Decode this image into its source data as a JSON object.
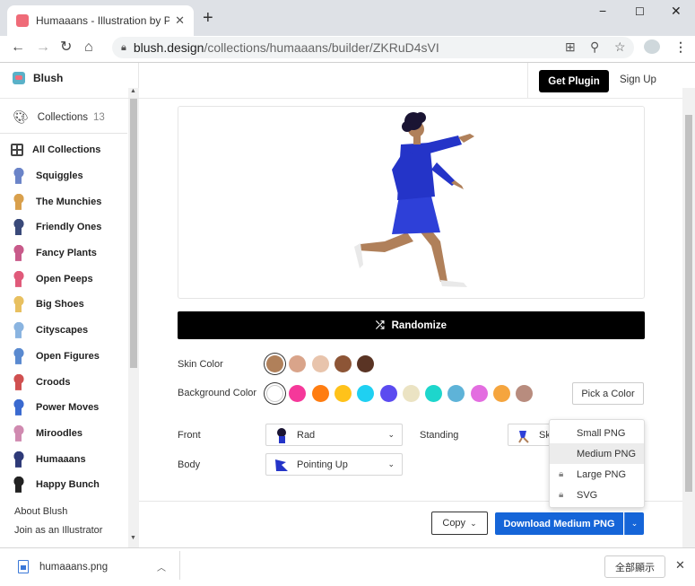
{
  "browser": {
    "tab_title": "Humaaans - Illustration by Pablo Stanley",
    "tab_close": "✕",
    "new_tab": "+",
    "url_host": "blush.design",
    "url_path": "/collections/humaaans/builder/ZKRuD4sVI",
    "window_controls": [
      "−",
      "☐",
      "✕"
    ]
  },
  "header": {
    "brand": "Blush",
    "get_plugin": "Get Plugin",
    "sign_up": "Sign Up"
  },
  "sidebar": {
    "collections_label": "Collections",
    "collections_count": "13",
    "items": [
      {
        "label": "All Collections",
        "icon": "grid-icon"
      },
      {
        "label": "Squiggles",
        "icon": "squiggles-thumb"
      },
      {
        "label": "The Munchies",
        "icon": "munchies-thumb"
      },
      {
        "label": "Friendly Ones",
        "icon": "friendly-ones-thumb"
      },
      {
        "label": "Fancy Plants",
        "icon": "fancy-plants-thumb"
      },
      {
        "label": "Open Peeps",
        "icon": "open-peeps-thumb"
      },
      {
        "label": "Big Shoes",
        "icon": "big-shoes-thumb"
      },
      {
        "label": "Cityscapes",
        "icon": "cityscapes-thumb"
      },
      {
        "label": "Open Figures",
        "icon": "open-figures-thumb"
      },
      {
        "label": "Croods",
        "icon": "croods-thumb"
      },
      {
        "label": "Power Moves",
        "icon": "power-moves-thumb"
      },
      {
        "label": "Miroodles",
        "icon": "miroodles-thumb"
      },
      {
        "label": "Humaaans",
        "icon": "humaaans-thumb"
      },
      {
        "label": "Happy Bunch",
        "icon": "happy-bunch-thumb"
      }
    ],
    "about": "About Blush",
    "join": "Join as an Illustrator"
  },
  "builder": {
    "randomize": "Randomize",
    "skin_color_label": "Skin Color",
    "skin_colors": [
      "#b0805a",
      "#d9a48a",
      "#e8c4ac",
      "#8d5536",
      "#5a3424"
    ],
    "background_color_label": "Background Color",
    "background_colors": [
      "#ffffff",
      "#f5389a",
      "#ff7d11",
      "#ffc21a",
      "#1fd0f2",
      "#5b4bf0",
      "#ebe3c3",
      "#1dd6cc",
      "#5eb3d8",
      "#e36de0",
      "#f5a53e",
      "#b88c7e"
    ],
    "pick_color": "Pick a Color",
    "front_label": "Front",
    "front_value": "Rad",
    "standing_label": "Standing",
    "standing_value": "Sk",
    "body_label": "Body",
    "body_value": "Pointing Up"
  },
  "actions": {
    "copy": "Copy",
    "download": "Download Medium PNG",
    "download_options": [
      {
        "label": "Small PNG",
        "locked": false
      },
      {
        "label": "Medium PNG",
        "locked": false
      },
      {
        "label": "Large PNG",
        "locked": true
      },
      {
        "label": "SVG",
        "locked": true
      }
    ]
  },
  "downloads_bar": {
    "file": "humaaans.png",
    "show_all": "全部顯示"
  }
}
